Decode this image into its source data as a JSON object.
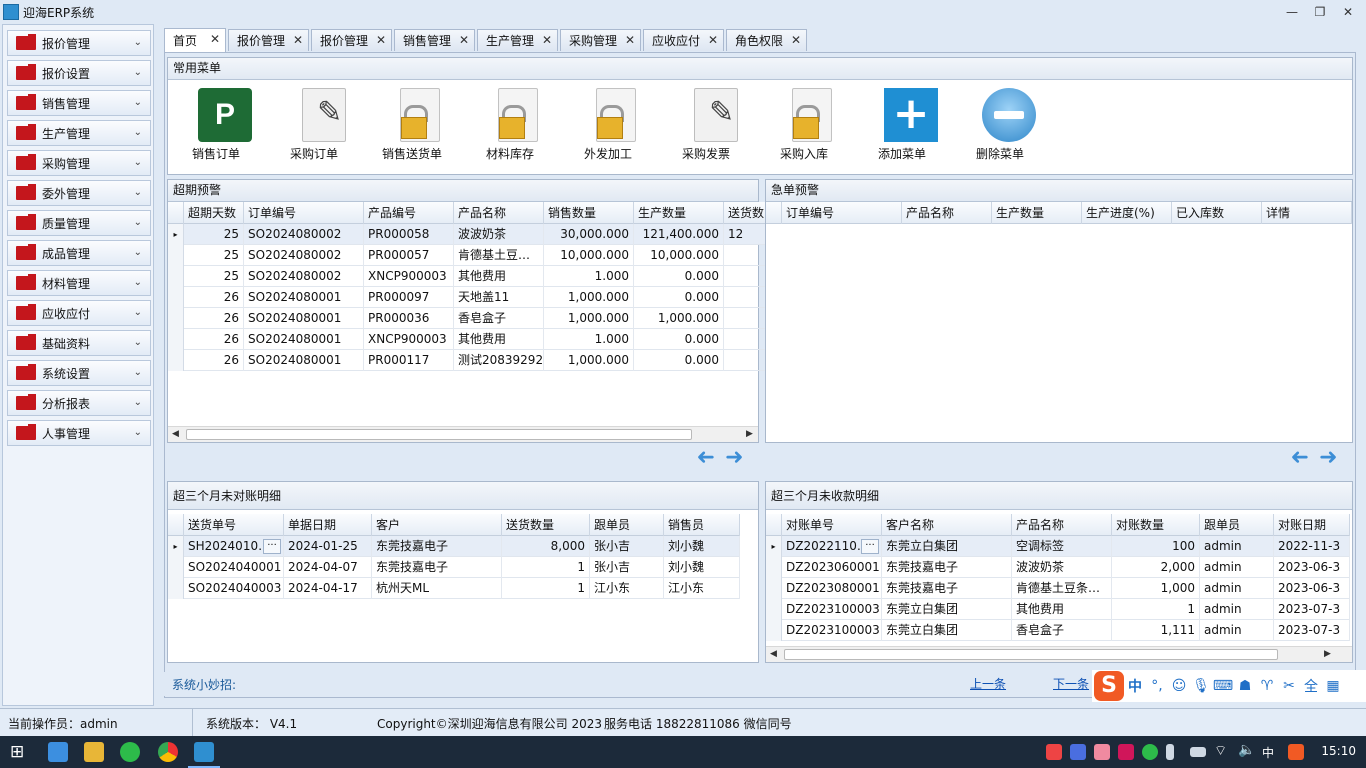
{
  "window": {
    "title": "迎海ERP系统",
    "minimize": "—",
    "restore": "❐",
    "close": "✕"
  },
  "sidebar": {
    "items": [
      {
        "label": "报价管理"
      },
      {
        "label": "报价设置"
      },
      {
        "label": "销售管理"
      },
      {
        "label": "生产管理"
      },
      {
        "label": "采购管理"
      },
      {
        "label": "委外管理"
      },
      {
        "label": "质量管理"
      },
      {
        "label": "成品管理"
      },
      {
        "label": "材料管理"
      },
      {
        "label": "应收应付"
      },
      {
        "label": "基础资料"
      },
      {
        "label": "系统设置"
      },
      {
        "label": "分析报表"
      },
      {
        "label": "人事管理"
      }
    ],
    "chevron": "⌄"
  },
  "tabs": [
    {
      "label": "首页"
    },
    {
      "label": "报价管理"
    },
    {
      "label": "报价管理"
    },
    {
      "label": "销售管理"
    },
    {
      "label": "生产管理"
    },
    {
      "label": "采购管理"
    },
    {
      "label": "应收应付"
    },
    {
      "label": "角色权限"
    }
  ],
  "tab_close": "✕",
  "quick_menu": {
    "title": "常用菜单",
    "items": [
      {
        "label": "销售订单",
        "icon": "project-icon",
        "glyph": "P"
      },
      {
        "label": "采购订单",
        "icon": "document-pen-icon"
      },
      {
        "label": "销售送货单",
        "icon": "locked-document-icon"
      },
      {
        "label": "材料库存",
        "icon": "locked-document-icon"
      },
      {
        "label": "外发加工",
        "icon": "locked-document-icon"
      },
      {
        "label": "采购发票",
        "icon": "document-pen-icon"
      },
      {
        "label": "采购入库",
        "icon": "locked-document-icon"
      },
      {
        "label": "添加菜单",
        "icon": "plus-icon",
        "glyph": "+"
      },
      {
        "label": "删除菜单",
        "icon": "minus-circle-icon"
      }
    ]
  },
  "overdue": {
    "title": "超期预警",
    "columns": [
      "超期天数",
      "订单编号",
      "产品编号",
      "产品名称",
      "销售数量",
      "生产数量",
      "送货数"
    ],
    "rows": [
      [
        "25",
        "SO2024080002",
        "PR000058",
        "波波奶茶",
        "30,000.000",
        "121,400.000",
        "12"
      ],
      [
        "25",
        "SO2024080002",
        "PR000057",
        "肯德基土豆…",
        "10,000.000",
        "10,000.000",
        ""
      ],
      [
        "25",
        "SO2024080002",
        "XNCP900003",
        "其他费用",
        "1.000",
        "0.000",
        ""
      ],
      [
        "26",
        "SO2024080001",
        "PR000097",
        "天地盖11",
        "1,000.000",
        "0.000",
        ""
      ],
      [
        "26",
        "SO2024080001",
        "PR000036",
        "香皂盒子",
        "1,000.000",
        "1,000.000",
        ""
      ],
      [
        "26",
        "SO2024080001",
        "XNCP900003",
        "其他费用",
        "1.000",
        "0.000",
        ""
      ],
      [
        "26",
        "SO2024080001",
        "PR000117",
        "测试20839292",
        "1,000.000",
        "0.000",
        ""
      ]
    ],
    "row_marker": "▸"
  },
  "urgent": {
    "title": "急单预警",
    "columns": [
      "订单编号",
      "产品名称",
      "生产数量",
      "生产进度(%)",
      "已入库数",
      "详情"
    ]
  },
  "unreconciled": {
    "title": "超三个月未对账明细",
    "columns": [
      "送货单号",
      "单据日期",
      "客户",
      "送货数量",
      "跟单员",
      "销售员"
    ],
    "rows": [
      [
        "SH2024010…",
        "2024-01-25",
        "东莞技嘉电子",
        "8,000",
        "张小吉",
        "刘小魏"
      ],
      [
        "SO2024040001",
        "2024-04-07",
        "东莞技嘉电子",
        "1",
        "张小吉",
        "刘小魏"
      ],
      [
        "SO2024040003",
        "2024-04-17",
        "杭州天ML",
        "1",
        "江小东",
        "江小东"
      ]
    ]
  },
  "uncollected": {
    "title": "超三个月未收款明细",
    "columns": [
      "对账单号",
      "客户名称",
      "产品名称",
      "对账数量",
      "跟单员",
      "对账日期"
    ],
    "rows": [
      [
        "DZ2022110…",
        "东莞立白集团",
        "空调标签",
        "100",
        "admin",
        "2022-11-3"
      ],
      [
        "DZ2023060001",
        "东莞技嘉电子",
        "波波奶茶",
        "2,000",
        "admin",
        "2023-06-3"
      ],
      [
        "DZ2023080001",
        "东莞技嘉电子",
        "肯德基土豆条…",
        "1,000",
        "admin",
        "2023-06-3"
      ],
      [
        "DZ2023100003",
        "东莞立白集团",
        "其他费用",
        "1",
        "admin",
        "2023-07-3"
      ],
      [
        "DZ2023100003",
        "东莞立白集团",
        "香皂盒子",
        "1,111",
        "admin",
        "2023-07-3"
      ]
    ]
  },
  "ellipsis": "···",
  "nav_prev": "➜",
  "nav_next": "➜",
  "tips": {
    "label": "系统小妙招:",
    "prev": "上一条",
    "next": "下一条"
  },
  "status": {
    "operator": "当前操作员：admin",
    "version": "系统版本： V4.1",
    "copyright": "Copyright©深圳迎海信息有限公司 2023",
    "service": "服务电话 18822811086 微信同号"
  },
  "ime": {
    "logo": "S",
    "lang": "中"
  },
  "taskbar": {
    "lang": "中",
    "time": "15:10"
  },
  "colors": {
    "accent": "#1f8fd3",
    "sidebar_icon": "#c4161c",
    "taskbar": "#1c2a3a"
  }
}
